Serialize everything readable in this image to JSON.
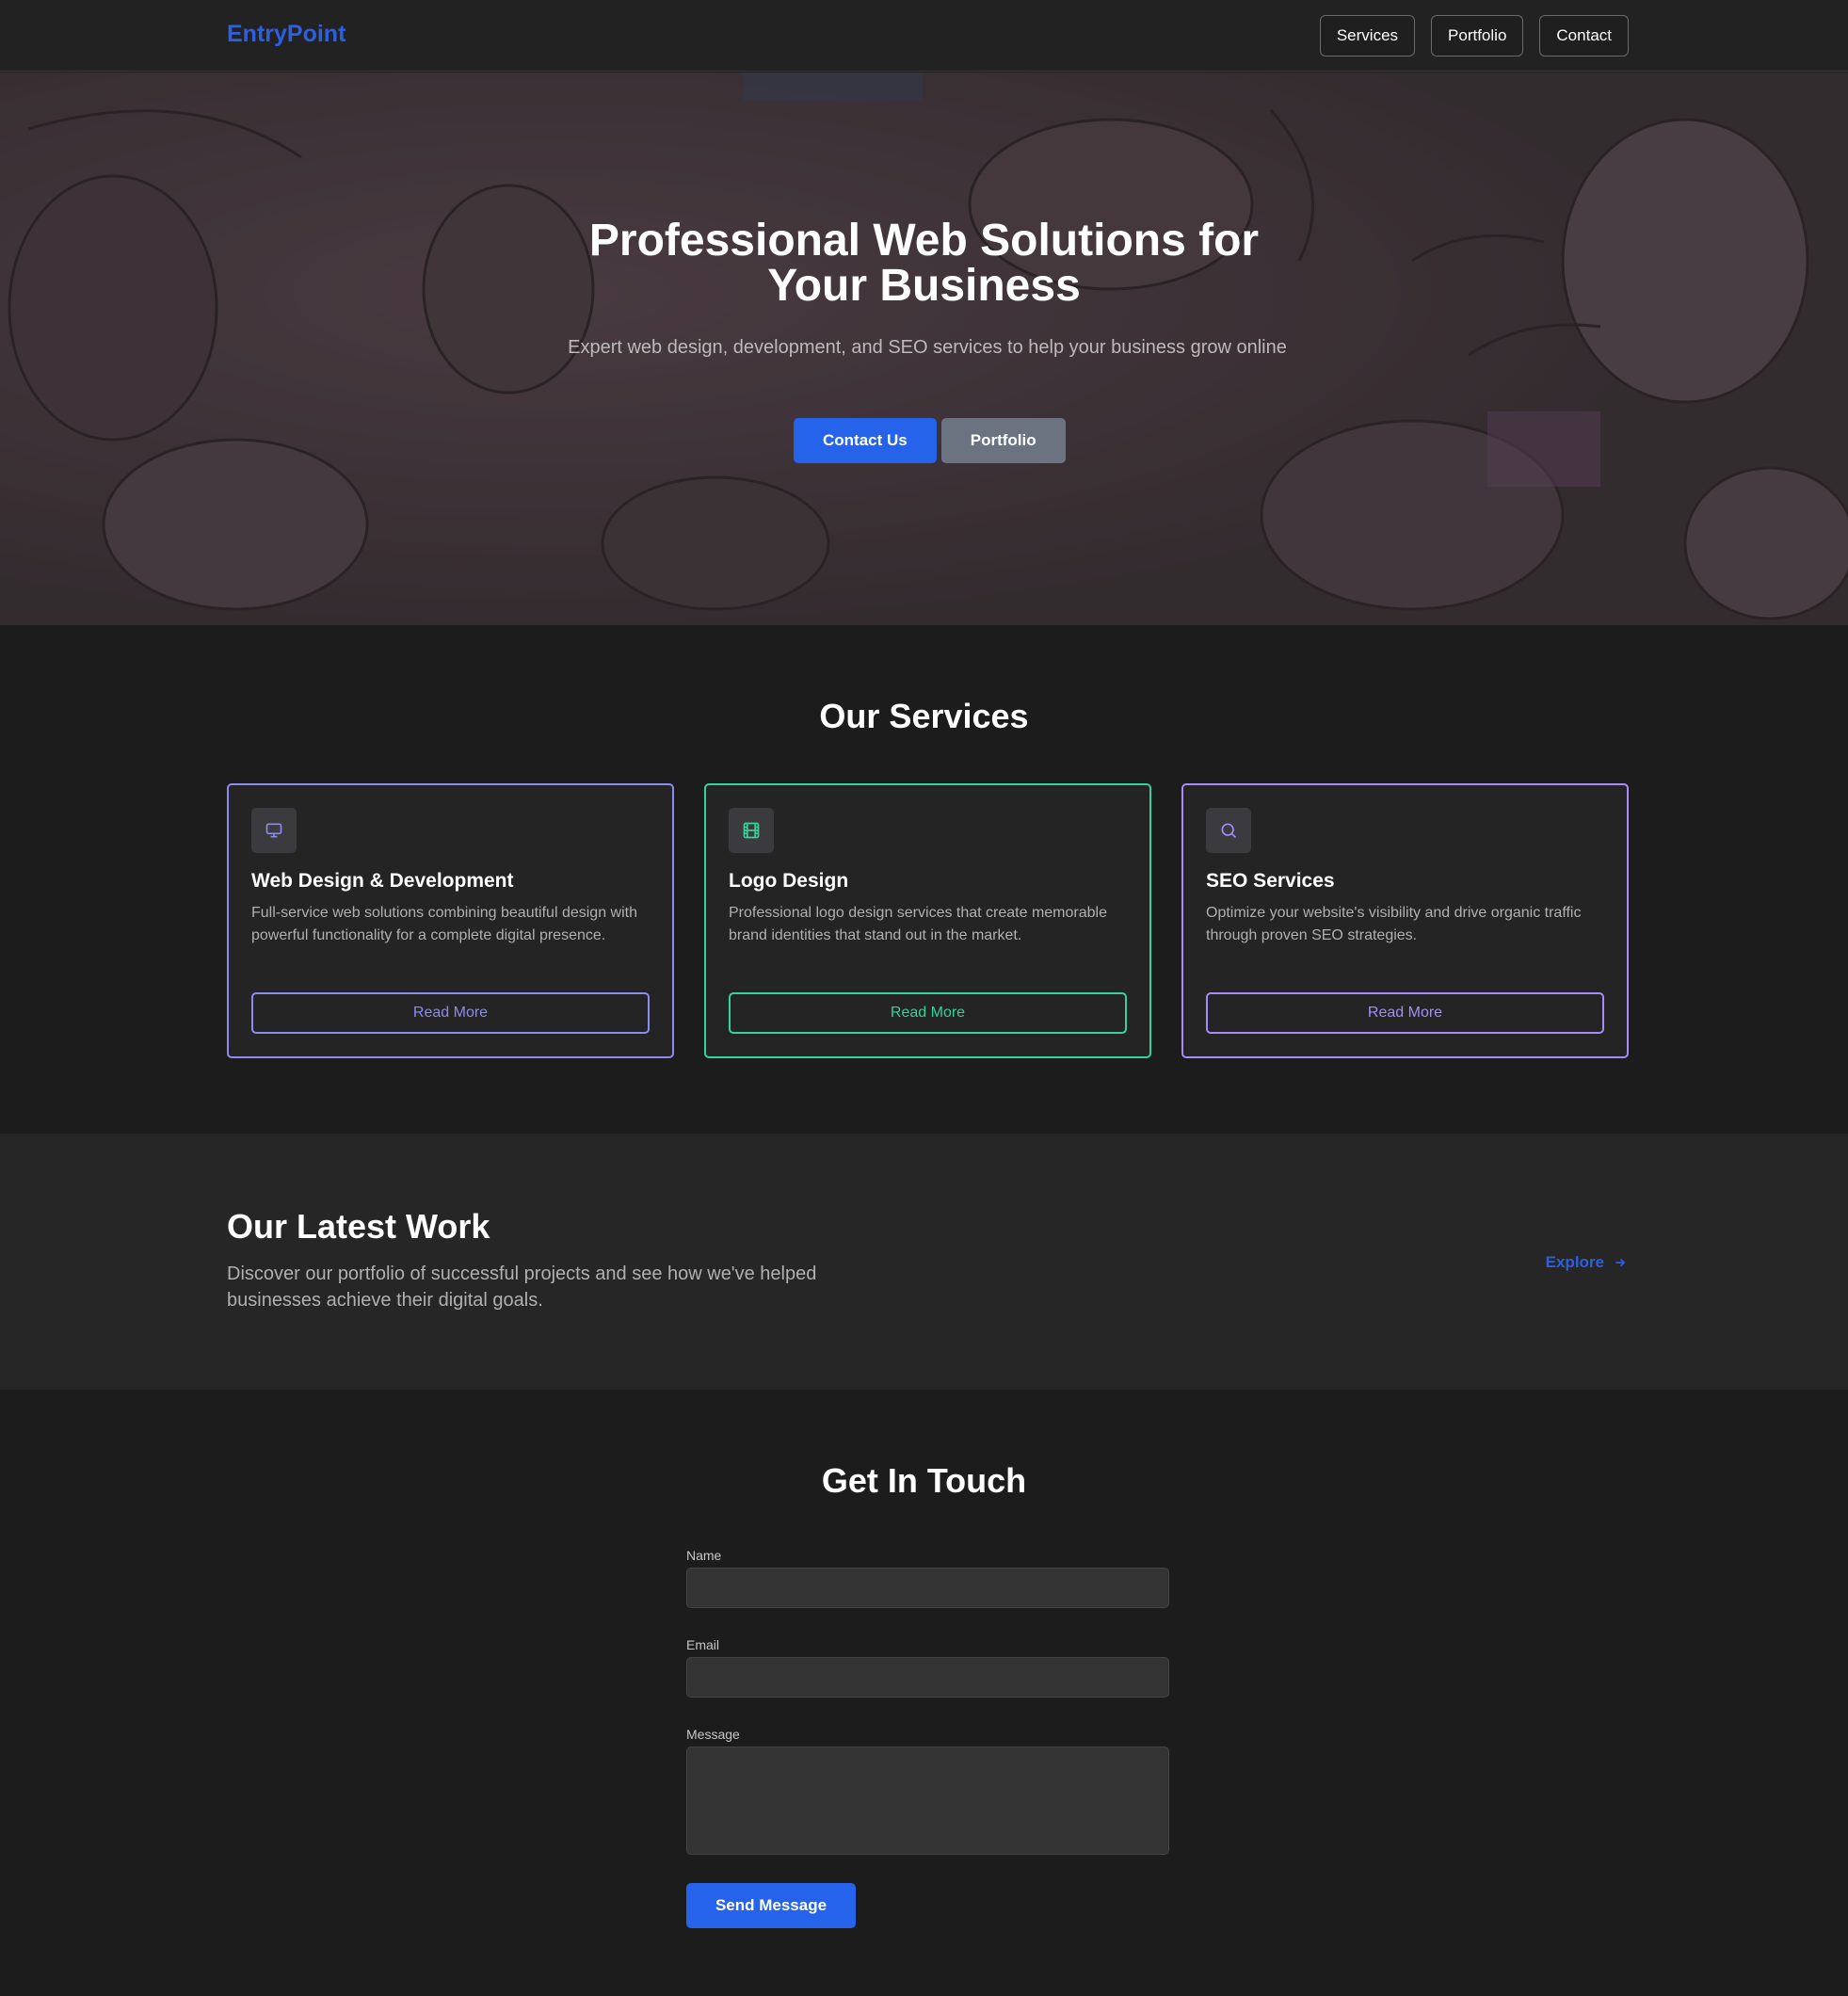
{
  "header": {
    "logo": "EntryPoint",
    "nav": [
      "Services",
      "Portfolio",
      "Contact"
    ]
  },
  "hero": {
    "title_line1": "Professional Web Solutions for",
    "title_line2": "Your Business",
    "subtitle": "Expert web design, development, and SEO services to help your business grow online",
    "primary_button": "Contact Us",
    "secondary_button": "Portfolio"
  },
  "services": {
    "title": "Our Services",
    "cards": [
      {
        "icon": "monitor-icon",
        "title": "Web Design & Development",
        "text": "Full-service web solutions combining beautiful design with powerful functionality for a complete digital presence.",
        "button": "Read More",
        "accent": "#8b8bf0"
      },
      {
        "icon": "film-icon",
        "title": "Logo Design",
        "text": "Professional logo design services that create memorable brand identities that stand out in the market.",
        "button": "Read More",
        "accent": "#34d399"
      },
      {
        "icon": "search-icon",
        "title": "SEO Services",
        "text": "Optimize your website's visibility and drive organic traffic through proven SEO strategies.",
        "button": "Read More",
        "accent": "#a78bfa"
      }
    ]
  },
  "work": {
    "title": "Our Latest Work",
    "text": "Discover our portfolio of successful projects and see how we've helped businesses achieve their digital goals.",
    "explore": "Explore"
  },
  "contact": {
    "title": "Get In Touch",
    "name_label": "Name",
    "email_label": "Email",
    "message_label": "Message",
    "name_value": "",
    "email_value": "",
    "message_value": "",
    "submit": "Send Message"
  },
  "colors": {
    "brand": "#2d5fdf",
    "primary_button": "#2563eb",
    "secondary_button": "#6b7280"
  }
}
